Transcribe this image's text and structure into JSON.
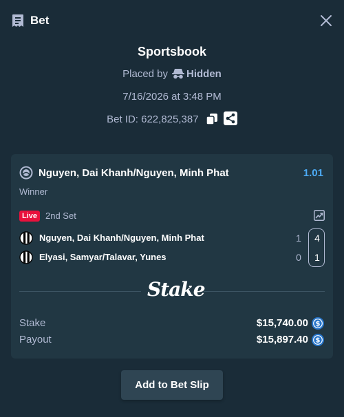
{
  "header": {
    "title": "Bet",
    "icon": "receipt-icon",
    "close_icon": "close-icon"
  },
  "bet": {
    "title": "Sportsbook",
    "placed_by_label": "Placed by",
    "placed_by_icon": "incognito-icon",
    "placed_by_name": "Hidden",
    "date": "7/16/2026 at 3:48 PM",
    "bet_id": "Bet ID: 622,825,387",
    "copy_icon": "copy-icon",
    "share_icon": "share-icon"
  },
  "selection": {
    "event_icon": "tennis-ball-icon",
    "name": "Nguyen, Dai Khanh/Nguyen, Minh Phat",
    "odds": "1.01",
    "market": "Winner",
    "live_badge": "Live",
    "period": "2nd Set",
    "stats_icon": "chart-icon",
    "players": [
      {
        "name": "Nguyen, Dai Khanh/Nguyen, Minh Phat",
        "game_score": "1",
        "set_score": "4"
      },
      {
        "name": "Elyasi, Samyar/Talavar, Yunes",
        "game_score": "0",
        "set_score": "1"
      }
    ]
  },
  "brand": {
    "logo_text": "Stake"
  },
  "totals": {
    "stake_label": "Stake",
    "stake_value": "$15,740.00",
    "payout_label": "Payout",
    "payout_value": "$15,897.40",
    "currency_icon": "usdc-coin-icon"
  },
  "actions": {
    "add_to_slip": "Add to Bet Slip"
  },
  "colors": {
    "background": "#1a2c38",
    "card": "#213743",
    "button": "#2f4553",
    "accent_blue": "#4dabf5",
    "live_red": "#e9113c",
    "muted_text": "#b1bad3",
    "coin_blue": "#2775ca"
  }
}
